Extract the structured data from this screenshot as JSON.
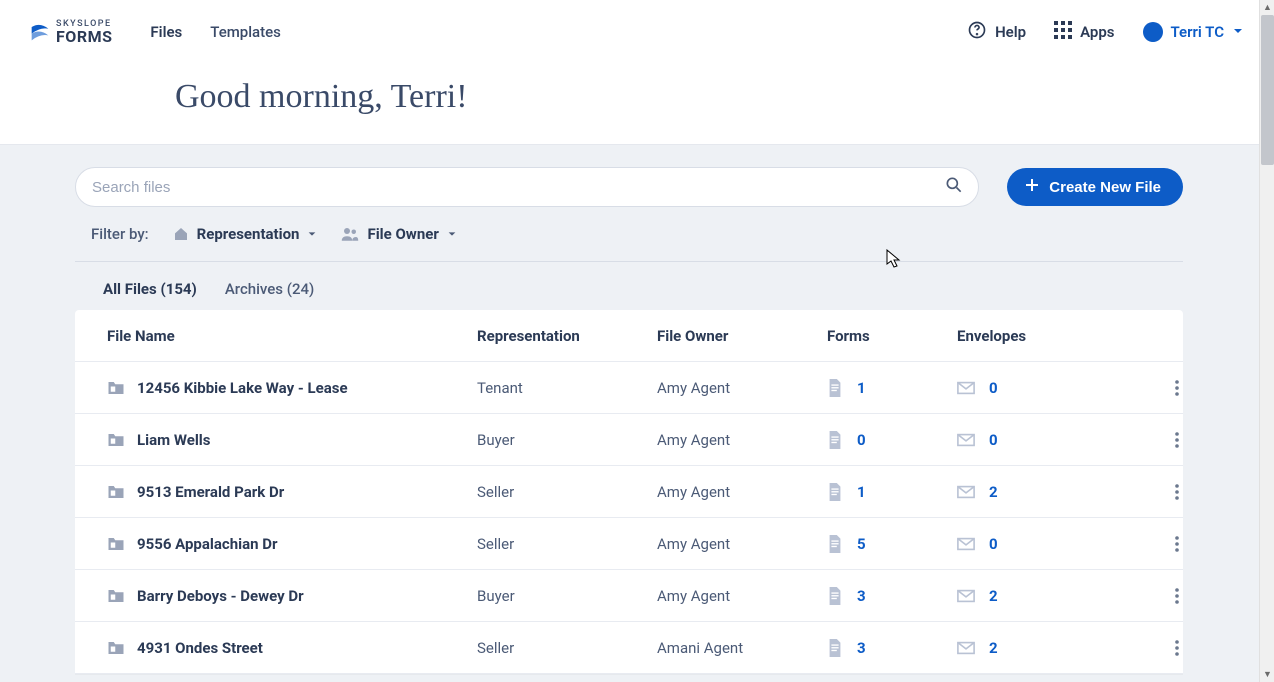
{
  "brand": {
    "small": "SKYSLOPE",
    "big": "FORMS"
  },
  "nav": {
    "files": "Files",
    "templates": "Templates"
  },
  "toolbar": {
    "help": "Help",
    "apps": "Apps",
    "user_name": "Terri TC"
  },
  "greeting": "Good morning, Terri!",
  "search": {
    "placeholder": "Search files"
  },
  "create_button": "Create New File",
  "filters": {
    "label": "Filter by:",
    "representation": "Representation",
    "file_owner": "File Owner"
  },
  "tabs": {
    "all_label": "All Files",
    "all_count": 154,
    "archives_label": "Archives",
    "archives_count": 24
  },
  "columns": {
    "file_name": "File Name",
    "representation": "Representation",
    "file_owner": "File Owner",
    "forms": "Forms",
    "envelopes": "Envelopes"
  },
  "rows": [
    {
      "name": "12456 Kibbie Lake Way - Lease",
      "rep": "Tenant",
      "owner": "Amy Agent",
      "forms": 1,
      "envelopes": 0
    },
    {
      "name": "Liam Wells",
      "rep": "Buyer",
      "owner": "Amy Agent",
      "forms": 0,
      "envelopes": 0
    },
    {
      "name": "9513 Emerald Park Dr",
      "rep": "Seller",
      "owner": "Amy Agent",
      "forms": 1,
      "envelopes": 2
    },
    {
      "name": "9556 Appalachian Dr",
      "rep": "Seller",
      "owner": "Amy Agent",
      "forms": 5,
      "envelopes": 0
    },
    {
      "name": "Barry Deboys - Dewey Dr",
      "rep": "Buyer",
      "owner": "Amy Agent",
      "forms": 3,
      "envelopes": 2
    },
    {
      "name": "4931 Ondes Street",
      "rep": "Seller",
      "owner": "Amani Agent",
      "forms": 3,
      "envelopes": 2
    }
  ]
}
